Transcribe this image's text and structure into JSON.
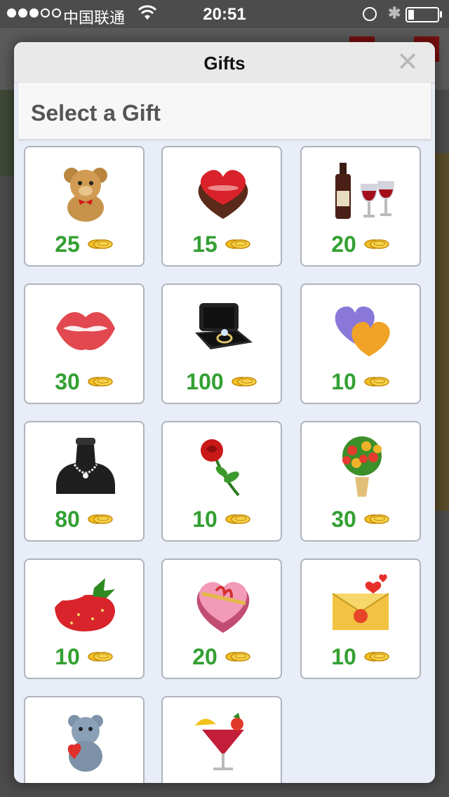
{
  "status_bar": {
    "carrier": "中国联通",
    "time": "20:51",
    "signal_bars": 3
  },
  "modal": {
    "title": "Gifts",
    "close_icon": "close-icon"
  },
  "section": {
    "title": "Select a Gift"
  },
  "colors": {
    "price_green": "#33a032",
    "modal_bg": "#e8edf8"
  },
  "gifts": [
    {
      "icon": "teddy-bear-icon",
      "price": "25"
    },
    {
      "icon": "heart-chocolate-box-icon",
      "price": "15"
    },
    {
      "icon": "wine-bottle-glasses-icon",
      "price": "20"
    },
    {
      "icon": "lips-kiss-icon",
      "price": "30"
    },
    {
      "icon": "ring-box-icon",
      "price": "100"
    },
    {
      "icon": "two-hearts-icon",
      "price": "10"
    },
    {
      "icon": "necklace-icon",
      "price": "80"
    },
    {
      "icon": "rose-icon",
      "price": "10"
    },
    {
      "icon": "flower-bouquet-icon",
      "price": "30"
    },
    {
      "icon": "strawberry-cream-icon",
      "price": "10"
    },
    {
      "icon": "heart-gift-box-icon",
      "price": "20"
    },
    {
      "icon": "love-letter-icon",
      "price": "10"
    },
    {
      "icon": "blue-bear-heart-icon",
      "price": ""
    },
    {
      "icon": "cocktail-icon",
      "price": ""
    }
  ]
}
